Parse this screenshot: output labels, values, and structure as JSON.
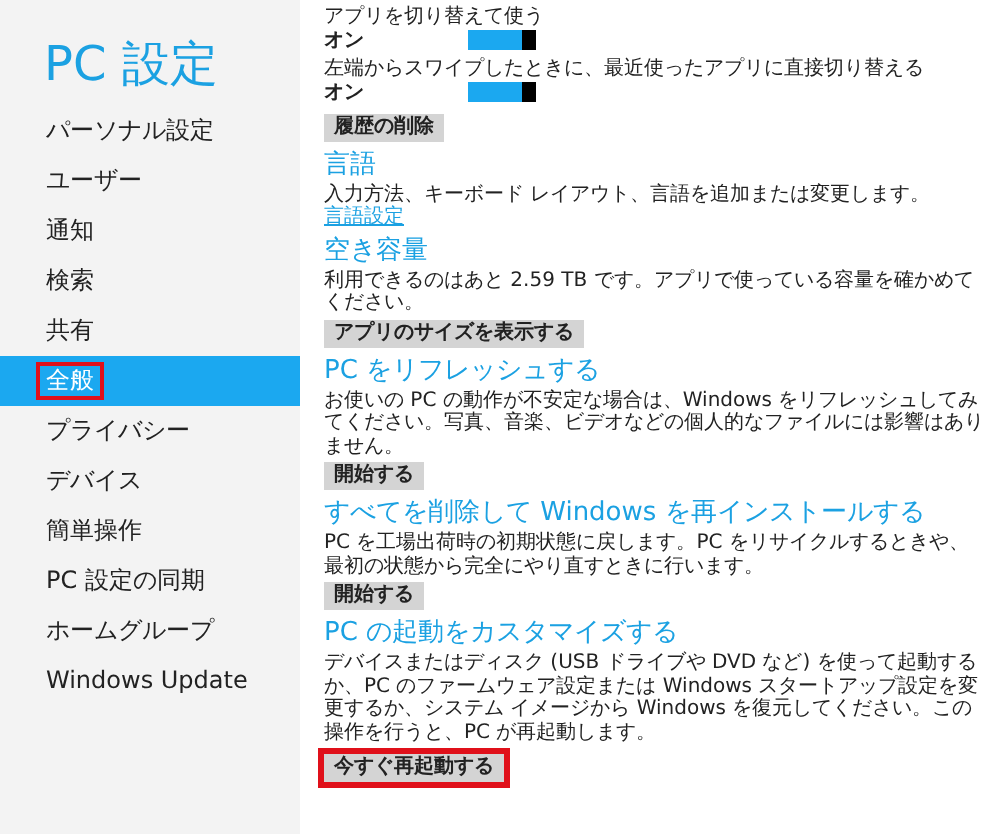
{
  "sidebar": {
    "title": "PC 設定",
    "items": [
      {
        "label": "パーソナル設定",
        "selected": false,
        "highlighted": false
      },
      {
        "label": "ユーザー",
        "selected": false,
        "highlighted": false
      },
      {
        "label": "通知",
        "selected": false,
        "highlighted": false
      },
      {
        "label": "検索",
        "selected": false,
        "highlighted": false
      },
      {
        "label": "共有",
        "selected": false,
        "highlighted": false
      },
      {
        "label": "全般",
        "selected": true,
        "highlighted": true
      },
      {
        "label": "プライバシー",
        "selected": false,
        "highlighted": false
      },
      {
        "label": "デバイス",
        "selected": false,
        "highlighted": false
      },
      {
        "label": "簡単操作",
        "selected": false,
        "highlighted": false
      },
      {
        "label": "PC 設定の同期",
        "selected": false,
        "highlighted": false
      },
      {
        "label": "ホームグループ",
        "selected": false,
        "highlighted": false
      },
      {
        "label": "Windows Update",
        "selected": false,
        "highlighted": false
      }
    ]
  },
  "content": [
    {
      "kind": "label",
      "text": "アプリを切り替えて使う"
    },
    {
      "kind": "toggle",
      "text": "オン",
      "on": true
    },
    {
      "kind": "label",
      "text": "左端からスワイプしたときに、最近使ったアプリに直接切り替える"
    },
    {
      "kind": "toggle",
      "text": "オン",
      "on": true
    },
    {
      "kind": "button",
      "text": "履歴の削除",
      "highlighted": false
    },
    {
      "kind": "heading",
      "text": "言語"
    },
    {
      "kind": "text",
      "text": "入力方法、キーボード レイアウト、言語を追加または変更します。"
    },
    {
      "kind": "link",
      "text": "言語設定"
    },
    {
      "kind": "heading",
      "text": "空き容量"
    },
    {
      "kind": "text",
      "text": "利用できるのはあと 2.59 TB です。アプリで使っている容量を確かめてください。"
    },
    {
      "kind": "button",
      "text": "アプリのサイズを表示する",
      "highlighted": false
    },
    {
      "kind": "heading",
      "text": "PC をリフレッシュする"
    },
    {
      "kind": "text",
      "text": "お使いの PC の動作が不安定な場合は、Windows をリフレッシュしてみてください。写真、音楽、ビデオなどの個人的なファイルには影響はありません。"
    },
    {
      "kind": "button",
      "text": "開始する",
      "highlighted": false
    },
    {
      "kind": "heading",
      "text": "すべてを削除して Windows を再インストールする"
    },
    {
      "kind": "text",
      "text": "PC を工場出荷時の初期状態に戻します。PC をリサイクルするときや、最初の状態から完全にやり直すときに行います。"
    },
    {
      "kind": "button",
      "text": "開始する",
      "highlighted": false
    },
    {
      "kind": "heading",
      "text": "PC の起動をカスタマイズする"
    },
    {
      "kind": "text",
      "text": "デバイスまたはディスク (USB ドライブや DVD など) を使って起動するか、PC のファームウェア設定または Windows スタートアップ設定を変更するか、システム イメージから Windows を復元してください。この操作を行うと、PC が再起動します。"
    },
    {
      "kind": "button",
      "text": "今すぐ再起動する",
      "highlighted": true
    }
  ]
}
